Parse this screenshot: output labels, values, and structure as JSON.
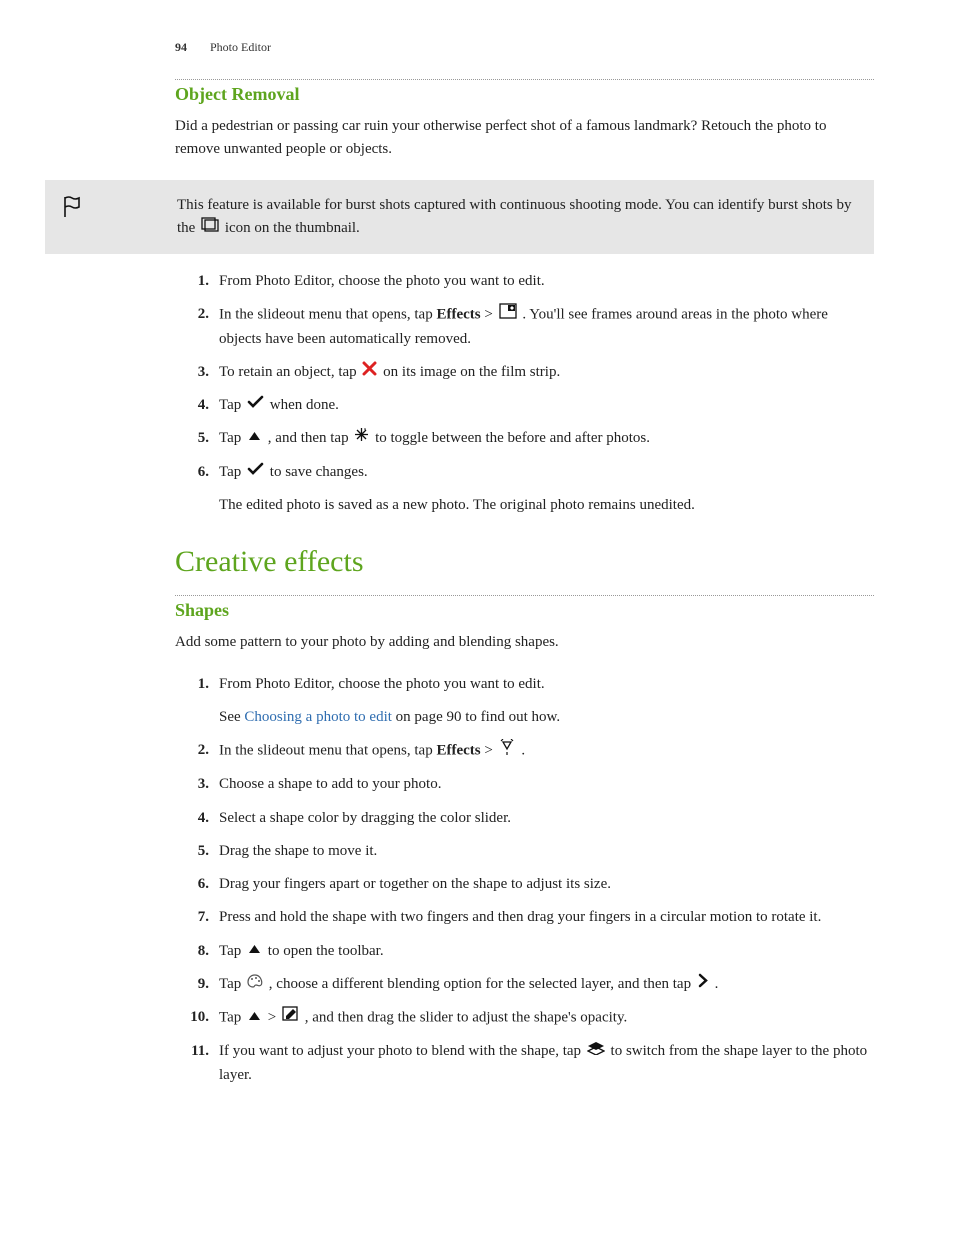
{
  "header": {
    "page_number": "94",
    "section": "Photo Editor"
  },
  "section1": {
    "title": "Object Removal",
    "intro": "Did a pedestrian or passing car ruin your otherwise perfect shot of a famous landmark? Retouch the photo to remove unwanted people or objects.",
    "note_a": "This feature is available for burst shots captured with continuous shooting mode. You can identify burst shots by the ",
    "note_b": " icon on the thumbnail.",
    "steps": {
      "s1": "From Photo Editor, choose the photo you want to edit.",
      "s2_a": "In the slideout menu that opens, tap ",
      "s2_effects": "Effects",
      "s2_gt": " > ",
      "s2_b": " . You'll see frames around areas in the photo where objects have been automatically removed.",
      "s3_a": "To retain an object, tap ",
      "s3_b": " on its image on the film strip.",
      "s4_a": "Tap ",
      "s4_b": " when done.",
      "s5_a": "Tap ",
      "s5_b": " , and then tap ",
      "s5_c": " to toggle between the before and after photos.",
      "s6_a": "Tap ",
      "s6_b": " to save changes.",
      "s6_sub": "The edited photo is saved as a new photo. The original photo remains unedited."
    }
  },
  "section2": {
    "title": "Creative effects",
    "sub_title": "Shapes",
    "intro": "Add some pattern to your photo by adding and blending shapes.",
    "steps": {
      "s1": "From Photo Editor, choose the photo you want to edit.",
      "s1_sub_a": "See ",
      "s1_link": "Choosing a photo to edit",
      "s1_sub_b": " on page 90 to find out how.",
      "s2_a": "In the slideout menu that opens, tap ",
      "s2_effects": "Effects",
      "s2_gt": " > ",
      "s2_b": " .",
      "s3": "Choose a shape to add to your photo.",
      "s4": "Select a shape color by dragging the color slider.",
      "s5": "Drag the shape to move it.",
      "s6": "Drag your fingers apart or together on the shape to adjust its size.",
      "s7": "Press and hold the shape with two fingers and then drag your fingers in a circular motion to rotate it.",
      "s8_a": "Tap ",
      "s8_b": " to open the toolbar.",
      "s9_a": "Tap ",
      "s9_b": " , choose a different blending option for the selected layer, and then tap ",
      "s9_c": " .",
      "s10_a": "Tap ",
      "s10_gt": " > ",
      "s10_b": ", and then drag the slider to adjust the shape's opacity.",
      "s11_a": "If you want to adjust your photo to blend with the shape, tap ",
      "s11_b": " to switch from the shape layer to the photo layer."
    }
  }
}
